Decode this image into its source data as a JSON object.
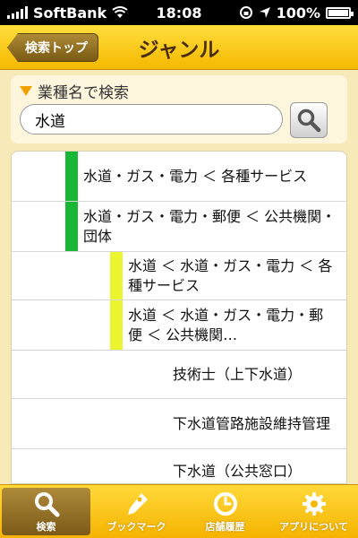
{
  "status_bar": {
    "carrier": "SoftBank",
    "time": "18:08",
    "battery": "100%"
  },
  "nav": {
    "back_label": "検索トップ",
    "title": "ジャンル"
  },
  "search": {
    "heading": "業種名で検索",
    "value": "水道",
    "placeholder": ""
  },
  "results": [
    {
      "level": 1,
      "text": "水道・ガス・電力 ＜ 各種サービス"
    },
    {
      "level": 1,
      "text": "水道・ガス・電力・郵便 ＜ 公共機関・団体"
    },
    {
      "level": 2,
      "text": "水道 ＜ 水道・ガス・電力 ＜ 各種サービス"
    },
    {
      "level": 2,
      "text": "水道 ＜ 水道・ガス・電力・郵便 ＜ 公共機関…"
    },
    {
      "level": 3,
      "text": "技術士（上下水道）"
    },
    {
      "level": 3,
      "text": "下水道管路施設維持管理"
    },
    {
      "level": 3,
      "text": "下水道（公共窓口）"
    }
  ],
  "tabs": [
    {
      "label": "検索",
      "icon": "search-icon",
      "active": true
    },
    {
      "label": "ブックマーク",
      "icon": "bookmark-icon",
      "active": false
    },
    {
      "label": "店舗履歴",
      "icon": "clock-icon",
      "active": false
    },
    {
      "label": "アプリについて",
      "icon": "gear-icon",
      "active": false
    }
  ],
  "colors": {
    "level1_bar": "#19b534",
    "level2_bar": "#eaf52f",
    "nav_yellow": "#f5b800"
  }
}
